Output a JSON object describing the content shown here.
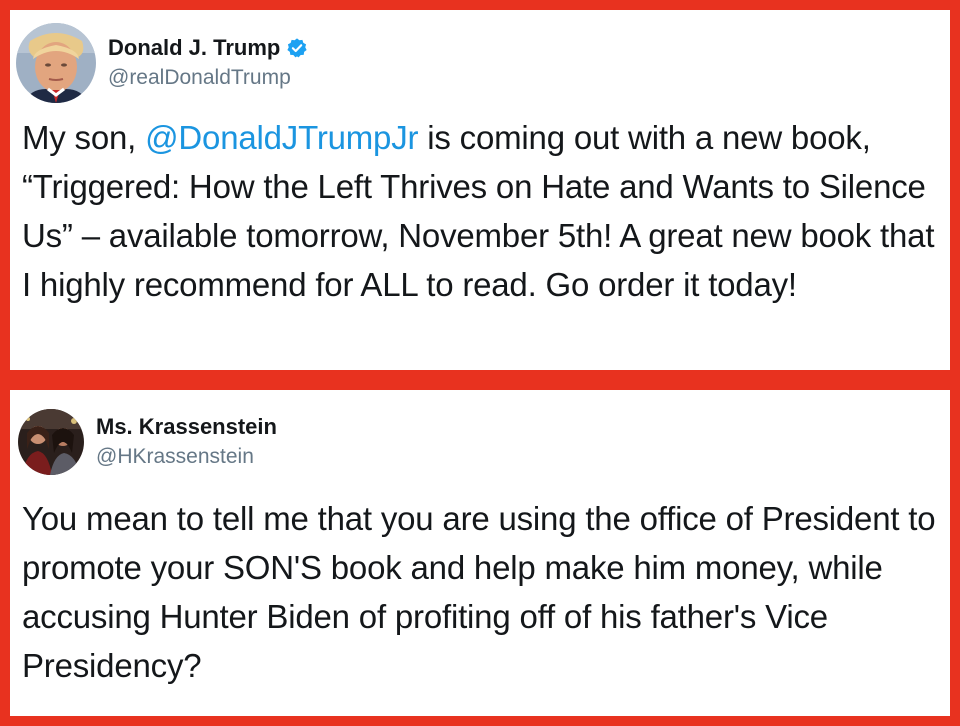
{
  "tweets": [
    {
      "display_name": "Donald J. Trump",
      "handle": "@realDonaldTrump",
      "verified": true,
      "avatar_icon": "portrait-avatar",
      "text_before_mention": "My son, ",
      "mention": "@DonaldJTrumpJr",
      "text_after_mention": " is coming out with a new book, “Triggered: How the Left Thrives on Hate and Wants to Silence Us” – available tomorrow, November 5th! A great new book that I highly recommend for ALL to read. Go order it today!"
    },
    {
      "display_name": "Ms. Krassenstein",
      "handle": "@HKrassenstein",
      "verified": false,
      "avatar_icon": "group-photo-avatar",
      "text": "You mean to tell me that you are using the office of President to promote your SON'S book and help make him money, while accusing Hunter Biden of profiting off of his father's Vice Presidency?"
    }
  ],
  "colors": {
    "border": "#e8321f",
    "mention": "#1b95e0",
    "verified": "#1da1f2",
    "handle": "#657786",
    "text": "#14171a"
  }
}
